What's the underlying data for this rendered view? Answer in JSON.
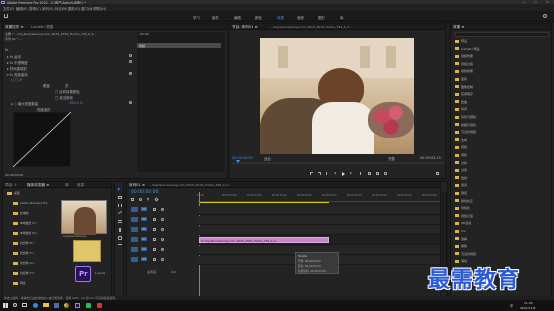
{
  "app": {
    "title": "Adobe Premiere Pro 2020 - C:\\用户\\Admin\\桌面\\1 *",
    "window_controls": [
      "—",
      "□",
      "✕"
    ],
    "menu": [
      "文件(F)",
      "编辑(E)",
      "剪辑(C)",
      "序列(S)",
      "标记(M)",
      "图形(G)",
      "窗口(W)",
      "帮助(H)"
    ]
  },
  "workspaces": {
    "items": [
      "学习",
      "组件",
      "编辑",
      "颜色",
      "效果",
      "音频",
      "图形",
      "库"
    ],
    "active": "效果"
  },
  "effect_controls": {
    "tabs": [
      "效果控件 ≡",
      "Lumetri 范围"
    ],
    "source": "主要 * ...img.tenorsanvng.com_2015_2016_Hunhs_794_0_2...",
    "sequence": "序列 01 * ...",
    "timecode": ":00:00",
    "clip_bar": "视频",
    "rows": [
      {
        "label": "fx",
        "value": ""
      },
      {
        "label": "▸ fx 运动",
        "value": ""
      },
      {
        "label": "▸ fx 不透明度",
        "value": ""
      },
      {
        "label": "▸ 时间重映射",
        "value": ""
      },
      {
        "label": "▾ fx 亮度曲线",
        "value": ""
      },
      {
        "label": "○ □ ✐",
        "value": ""
      }
    ],
    "sub_rows": [
      {
        "label": "覆盖",
        "value": "关"
      },
      {
        "label": "",
        "value": "□ 反转效果颜色"
      },
      {
        "label": "",
        "value": "□ 将当前帧"
      },
      {
        "label": "▸ ○ 最大亮度数量",
        "value": "100.0 %"
      }
    ],
    "curve_label": "亮度波形",
    "bottom_timecode": "00:00:00:00"
  },
  "program": {
    "title": "节目: 序列01 ≡",
    "source_title": "...img.tenorsanvng.com_2015_2016_Hunhs_794_0_2...",
    "timecode_left": "00:00:00:00",
    "fit": "适合",
    "quality": "完整",
    "timecode_right": "00:00:03:13"
  },
  "effects": {
    "title": "效果 ≡",
    "items": [
      "预设",
      "Lumetri 预设",
      "音频效果",
      "音频过渡",
      "视频效果",
      "变换",
      "图像控制",
      "实用程序",
      "扭曲",
      "时间",
      "杂色与颗粒",
      "模糊与锐化",
      "沉浸式视频",
      "生成",
      "视频",
      "调整",
      "过时",
      "过渡",
      "透视",
      "通道",
      "键控",
      "颜色校正",
      "风格化",
      "视频过渡",
      "3D运动",
      "Iris",
      "溶解",
      "擦除",
      "沉浸式视频",
      "滑动",
      "缩放",
      "页面剥落"
    ]
  },
  "project": {
    "tabs": [
      "项目: 1",
      "媒体浏览器 ≡",
      "库",
      "信息"
    ],
    "folders": [
      "桌面",
      "Adobe Premiere Pro",
      "此电脑",
      "本地磁盘 (C:)",
      "本地磁盘 (D:)",
      "新加卷 (E:)",
      "新加卷 (F:)",
      "新加卷 (G:)",
      "新加卷 (H:)",
      "网络"
    ],
    "thumb1_label": "...img.tenorsanvng...",
    "thumb2_label": "...",
    "pr_label": "Pr",
    "pr_caption": "1.prproj"
  },
  "timeline": {
    "title": "序列01 ≡",
    "tab2": "...img.tenorsanvng.com_2015_2016_Hunhs_794_0_2...",
    "timecode": "00:00:00:00",
    "ruler": [
      "00:00",
      "00:00:05:00",
      "00:00:10:00",
      "00:00:15:00",
      "00:00:20:00",
      "00:00:25:00",
      "00:00:30:00",
      "00:00:35:00",
      "00:00:40:00",
      "00:00:45:00"
    ],
    "tracks": [
      {
        "name": "V3",
        "kind": "video"
      },
      {
        "name": "V2",
        "kind": "video"
      },
      {
        "name": "V1",
        "kind": "video"
      },
      {
        "name": "A1",
        "kind": "audio"
      },
      {
        "name": "A2",
        "kind": "audio"
      },
      {
        "name": "A3",
        "kind": "audio"
      }
    ],
    "master": "主声道",
    "master_value": "0.0",
    "clip_label": "fx img.tenorsanvng.com_2015_2016_Hunhs_794_0_2...",
    "tooltip": {
      "name": "Hunhs",
      "start": "开始: 00;00;00;00",
      "end": "结束: 00;00;04;23",
      "duration": "持续时间: 00;00;05;00"
    }
  },
  "status": {
    "text": "单击以选择，或单击空白处并拖动以进行框选择。使用 Shift、Alt 和 Ctrl 可获得更多选项。"
  },
  "watermark": {
    "text": "最需教育"
  },
  "taskbar": {
    "time": "11:25",
    "date": "2021/11/9",
    "lang": "中"
  },
  "colors": {
    "accent": "#4a8fe0",
    "clip_video": "#c986c9",
    "playhead": "#4a8fe0",
    "work_area": "#d9d200"
  }
}
